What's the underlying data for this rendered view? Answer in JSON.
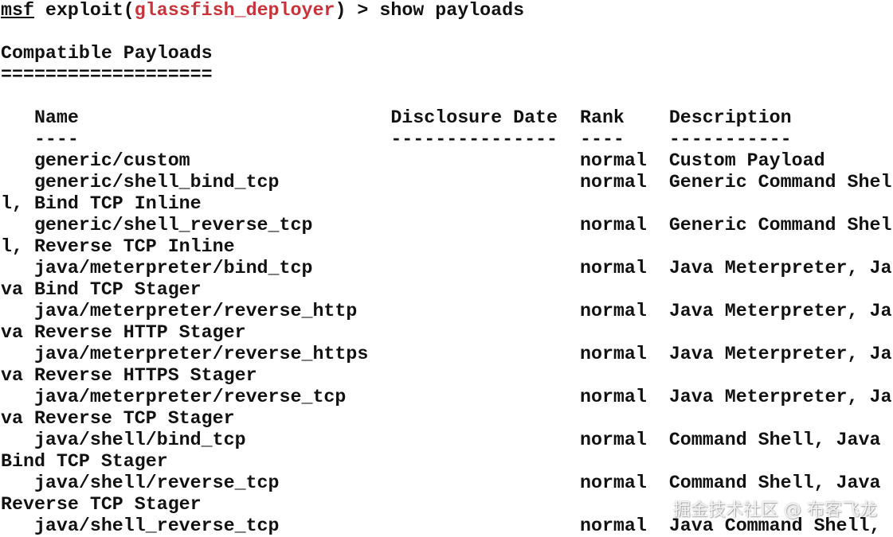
{
  "prompt": {
    "msf": "msf",
    "exploit_open": " exploit(",
    "module": "glassfish_deployer",
    "tail": ") > show payloads"
  },
  "lines": [
    "",
    "Compatible Payloads",
    "===================",
    "",
    "   Name                            Disclosure Date  Rank    Description",
    "   ----                            ---------------  ----    -----------",
    "   generic/custom                                   normal  Custom Payload",
    "   generic/shell_bind_tcp                           normal  Generic Command Shel",
    "l, Bind TCP Inline",
    "   generic/shell_reverse_tcp                        normal  Generic Command Shel",
    "l, Reverse TCP Inline",
    "   java/meterpreter/bind_tcp                        normal  Java Meterpreter, Ja",
    "va Bind TCP Stager",
    "   java/meterpreter/reverse_http                    normal  Java Meterpreter, Ja",
    "va Reverse HTTP Stager",
    "   java/meterpreter/reverse_https                   normal  Java Meterpreter, Ja",
    "va Reverse HTTPS Stager",
    "   java/meterpreter/reverse_tcp                     normal  Java Meterpreter, Ja",
    "va Reverse TCP Stager",
    "   java/shell/bind_tcp                              normal  Command Shell, Java ",
    "Bind TCP Stager",
    "   java/shell/reverse_tcp                           normal  Command Shell, Java ",
    "Reverse TCP Stager",
    "   java/shell_reverse_tcp                           normal  Java Command Shell, "
  ],
  "watermark": "掘金技术社区 @ 布客飞龙",
  "colors": {
    "text": "#111111",
    "module": "#c8323a",
    "background": "#ffffff"
  }
}
